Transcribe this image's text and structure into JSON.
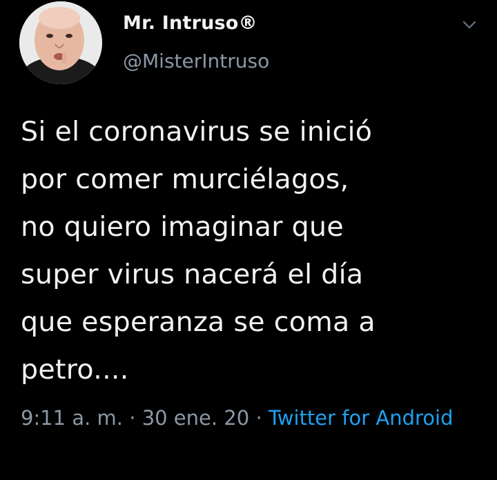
{
  "author": {
    "display_name": "Mr. Intruso®",
    "handle": "@MisterIntruso"
  },
  "tweet": {
    "lines": [
      "Si el coronavirus se inició",
      "por comer murciélagos,",
      "no quiero imaginar que",
      "super virus nacerá el día",
      "que esperanza se coma a",
      "petro...."
    ]
  },
  "meta": {
    "time": "9:11 a. m.",
    "separator": "·",
    "date": "30 ene. 20",
    "source": "Twitter for Android"
  },
  "colors": {
    "background": "#000000",
    "text": "#f2f2f2",
    "secondary": "#8b98a5",
    "link": "#1da1f2"
  },
  "icons": {
    "menu": "chevron-down-icon"
  }
}
